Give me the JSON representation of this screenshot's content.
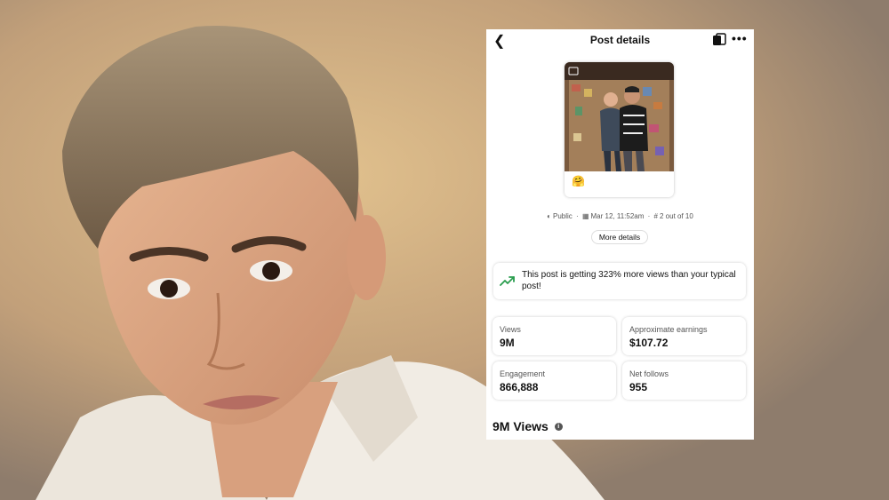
{
  "topbar": {
    "title": "Post details",
    "back_icon": "chevron-left-icon",
    "copy_icon": "copy-icon",
    "more_icon": "more-horizontal-icon"
  },
  "post": {
    "caption_emoji": "🤗"
  },
  "meta": {
    "visibility": "Public",
    "date": "Mar 12, 11:52am",
    "rank": "2 out of 10"
  },
  "more_details_label": "More details",
  "insight": {
    "text": "This post is getting 323% more views than your typical post!",
    "icon": "trending-up-icon",
    "icon_color": "#2a9d4e"
  },
  "stats": [
    {
      "label": "Views",
      "value": "9M"
    },
    {
      "label": "Approximate earnings",
      "value": "$107.72"
    },
    {
      "label": "Engagement",
      "value": "866,888"
    },
    {
      "label": "Net follows",
      "value": "955"
    }
  ],
  "views_heading": "9M Views",
  "info_icon": "info-icon"
}
